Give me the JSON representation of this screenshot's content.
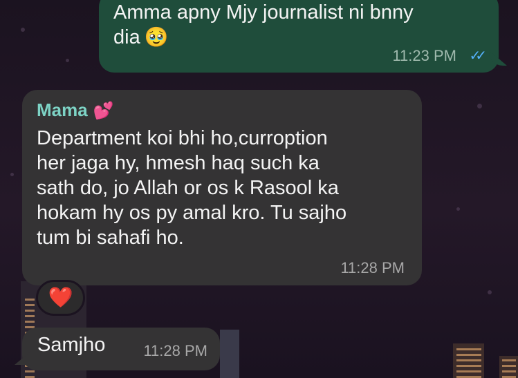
{
  "messages": [
    {
      "direction": "outgoing",
      "text": "Amma apny Mjy journalist ni bnny\ndia",
      "emoji": "🥹",
      "time": "11:23 PM",
      "status_icon": "double-check-read-icon",
      "status_glyph": "✓✓"
    },
    {
      "direction": "incoming",
      "sender": "Mama",
      "sender_emoji": "💕",
      "text": "Department koi bhi ho,curroption\nher jaga hy, hmesh haq such ka\nsath do, jo Allah or os k Rasool ka\nhokam hy os py amal kro. Tu sajho\ntum bi sahafi ho.",
      "time": "11:28 PM",
      "reaction": "❤️"
    },
    {
      "direction": "incoming",
      "text": "Samjho",
      "time": "11:28 PM"
    }
  ],
  "colors": {
    "outgoing_bubble": "#1f4d3b",
    "incoming_bubble": "#343334",
    "sender_name": "#7dd3c5",
    "read_ticks": "#56b3ff"
  }
}
